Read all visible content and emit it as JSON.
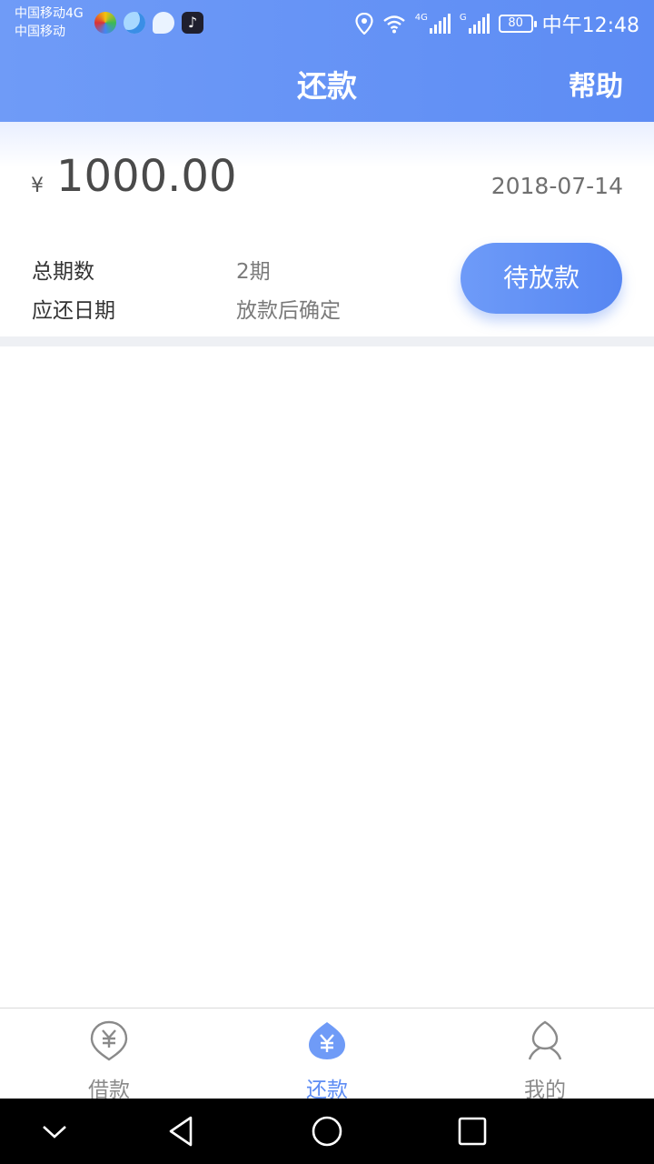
{
  "status_bar": {
    "carrier_line1": "中国移动4G",
    "carrier_line2": "中国移动",
    "network_1": "4G",
    "network_2": "G",
    "battery": "80",
    "time": "中午12:48"
  },
  "header": {
    "title": "还款",
    "help_label": "帮助",
    "gradient_start": "#6f9bf7",
    "gradient_end": "#5d8cf4"
  },
  "loan": {
    "currency_symbol": "¥",
    "amount": "1000.00",
    "date": "2018-07-14",
    "periods_label": "总期数",
    "periods_value": "2期",
    "due_label": "应还日期",
    "due_value": "放款后确定",
    "status_button": "待放款"
  },
  "tabs": [
    {
      "label": "借款",
      "icon": "yen-pin-icon",
      "active": false
    },
    {
      "label": "还款",
      "icon": "yen-drop-icon",
      "active": true
    },
    {
      "label": "我的",
      "icon": "user-icon",
      "active": false
    }
  ],
  "colors": {
    "accent": "#5d8cf4",
    "inactive": "#8a8a8a"
  }
}
